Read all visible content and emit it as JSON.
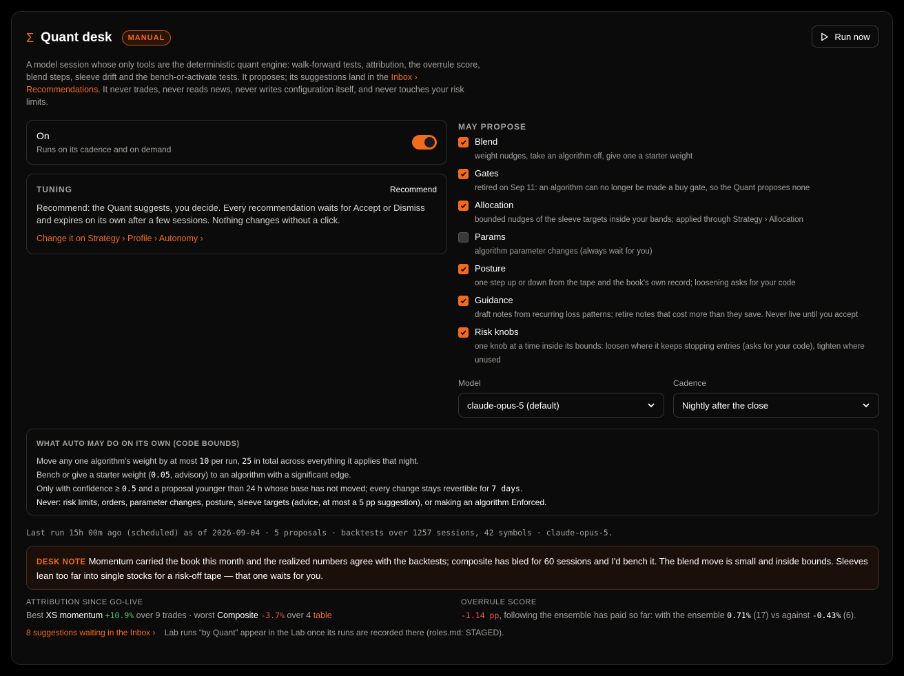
{
  "header": {
    "title": "Quant desk",
    "badge": "MANUAL",
    "run_label": "Run now"
  },
  "description": {
    "part1": "A model session whose only tools are the deterministic quant engine: walk-forward tests, attribution, the overrule score, blend steps, sleeve drift and the bench-or-activate tests. It proposes; its suggestions land in the ",
    "link": "Inbox › Recommendations",
    "part2": ". It never trades, never reads news, never writes configuration itself, and never touches your risk limits."
  },
  "status": {
    "title": "On",
    "subtitle": "Runs on its cadence and on demand",
    "enabled": true
  },
  "tuning": {
    "label": "TUNING",
    "mode": "Recommend",
    "text": "Recommend: the Quant suggests, you decide. Every recommendation waits for Accept or Dismiss and expires on its own after a few sessions. Nothing changes without a click.",
    "link": "Change it on Strategy › Profile › Autonomy ›"
  },
  "propose": {
    "label": "MAY PROPOSE",
    "items": [
      {
        "name": "Blend",
        "desc": "weight nudges, take an algorithm off, give one a starter weight",
        "checked": true
      },
      {
        "name": "Gates",
        "desc": "retired on Sep 11: an algorithm can no longer be made a buy gate, so the Quant proposes none",
        "checked": true
      },
      {
        "name": "Allocation",
        "desc": "bounded nudges of the sleeve targets inside your bands; applied through Strategy › Allocation",
        "checked": true
      },
      {
        "name": "Params",
        "desc": "algorithm parameter changes (always wait for you)",
        "checked": false
      },
      {
        "name": "Posture",
        "desc": "one step up or down from the tape and the book's own record; loosening asks for your code",
        "checked": true
      },
      {
        "name": "Guidance",
        "desc": "draft notes from recurring loss patterns; retire notes that cost more than they save. Never live until you accept",
        "checked": true
      },
      {
        "name": "Risk knobs",
        "desc": "one knob at a time inside its bounds: loosen where it keeps stopping entries (asks for your code), tighten where unused",
        "checked": true
      }
    ]
  },
  "selectors": {
    "model_label": "Model",
    "model_value": "claude-opus-5 (default)",
    "cadence_label": "Cadence",
    "cadence_value": "Nightly after the close"
  },
  "bounds": {
    "title": "WHAT AUTO MAY DO ON ITS OWN (CODE BOUNDS)",
    "l1a": "Move any one algorithm's weight by at most ",
    "l1v1": "10",
    "l1b": " per run, ",
    "l1v2": "25",
    "l1c": " in total across everything it applies that night.",
    "l2a": "Bench or give a starter weight (",
    "l2v": "0.05",
    "l2b": ", advisory) to an algorithm with a significant edge.",
    "l3a": "Only with confidence ≥ ",
    "l3v1": "0.5",
    "l3b": " and a proposal younger than 24 h whose base has not moved; every change stays revertible for ",
    "l3v2": "7 days",
    "l3c": ".",
    "l4": "Never: risk limits, orders, parameter changes, posture, sleeve targets (advice, at most a 5  pp suggestion), or making an algorithm Enforced."
  },
  "last_run": "Last run 15h 00m ago (scheduled) as of 2026-09-04 · 5 proposals · backtests over 1257 sessions, 42 symbols · claude-opus-5.",
  "desk_note": {
    "tag": "DESK NOTE",
    "text": "Momentum carried the book this month and the realized numbers agree with the backtests; composite has bled for 60 sessions and I'd bench it. The blend move is small and inside bounds. Sleeves lean too far into single stocks for a risk-off tape — that one waits for you."
  },
  "attribution": {
    "label": "ATTRIBUTION SINCE GO-LIVE",
    "best_prefix": "Best ",
    "best_name": "XS momentum",
    "best_value": "+10.9%",
    "best_trades": " over 9 trades · worst ",
    "worst_name": "Composite",
    "worst_value": "-3.7%",
    "worst_trades": " over 4 ",
    "table_link": "table"
  },
  "overrule": {
    "label": "OVERRULE SCORE",
    "value": "-1.14 pp",
    "text1": ", following the ensemble has paid so far: with the ensemble ",
    "with_value": "0.71%",
    "with_count": " (17) vs against ",
    "against_value": "-0.43%",
    "against_count": " (6)."
  },
  "footer": {
    "inbox_link": "8 suggestions waiting in the Inbox ›",
    "lab_text": "Lab runs “by Quant” appear in the Lab once its runs are recorded there (roles.md: STAGED)."
  },
  "colors": {
    "accent": "#f26b1d",
    "positive": "#3ec96b",
    "negative": "#f0564a"
  }
}
